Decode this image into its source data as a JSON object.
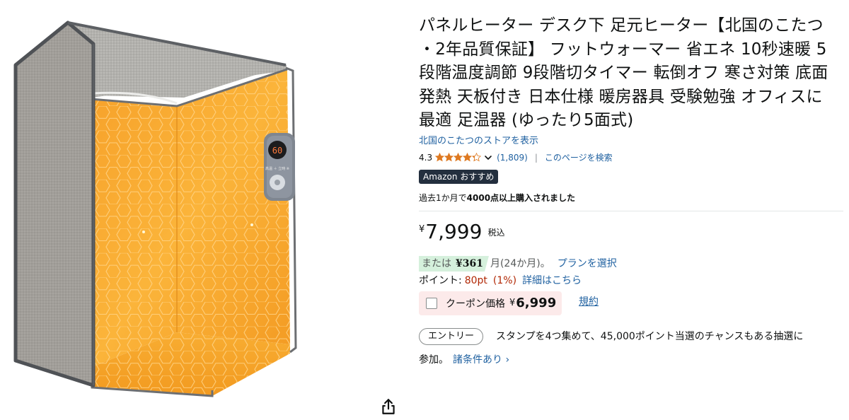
{
  "product": {
    "title": "パネルヒーター デスク下 足元ヒーター【北国のこたつ ・2年品質保証】 フットウォーマー 省エネ 10秒速暖 5段階温度調節 9段階切タイマー 転倒オフ 寒さ対策 底面発熱 天板付き 日本仕様 暖房器具 受験勉強 オフィスに最適 足温器 (ゆったり5面式)",
    "store_link": "北国のこたつのストアを表示",
    "heater_display": "60",
    "heater_label": "高温 ＋ 立時 ※"
  },
  "rating": {
    "value": "4.3",
    "stars": 4.3,
    "review_count": "(1,809)",
    "separator": "|",
    "search_page_link": "このページを検索"
  },
  "badge": {
    "label": "Amazon おすすめ"
  },
  "purchase_info": {
    "prefix": "過去1か月で",
    "emphasis": "4000点以上購入されました"
  },
  "price": {
    "symbol": "¥",
    "value": "7,999",
    "tax_label": "税込"
  },
  "installment": {
    "prefix": "または",
    "amount": "¥361",
    "term": "月(24か月)。",
    "plan_link": "プランを選択"
  },
  "points": {
    "label": "ポイント:",
    "value": "80pt",
    "percent": "(1%)",
    "details_link": "詳細はこちら"
  },
  "coupon": {
    "label": "クーポン価格",
    "symbol": "¥",
    "price": "6,999",
    "terms_link": "規約"
  },
  "entry": {
    "button_label": "エントリー",
    "text_line1": "スタンプを4つ集めて、45,000ポイント当選のチャンスもある抽選に",
    "text_line2": "参加。",
    "conditions_link": "諸条件あり ›"
  },
  "colors": {
    "link": "#2162a1",
    "price_red": "#b12704",
    "badge_dark": "#232f3e",
    "star_orange": "#de7921",
    "panel_orange": "#f5a623",
    "fabric_gray": "#9a9894"
  },
  "icons": {
    "share": "share-icon",
    "chevron": "chevron-down-icon",
    "star": "star-icon"
  }
}
